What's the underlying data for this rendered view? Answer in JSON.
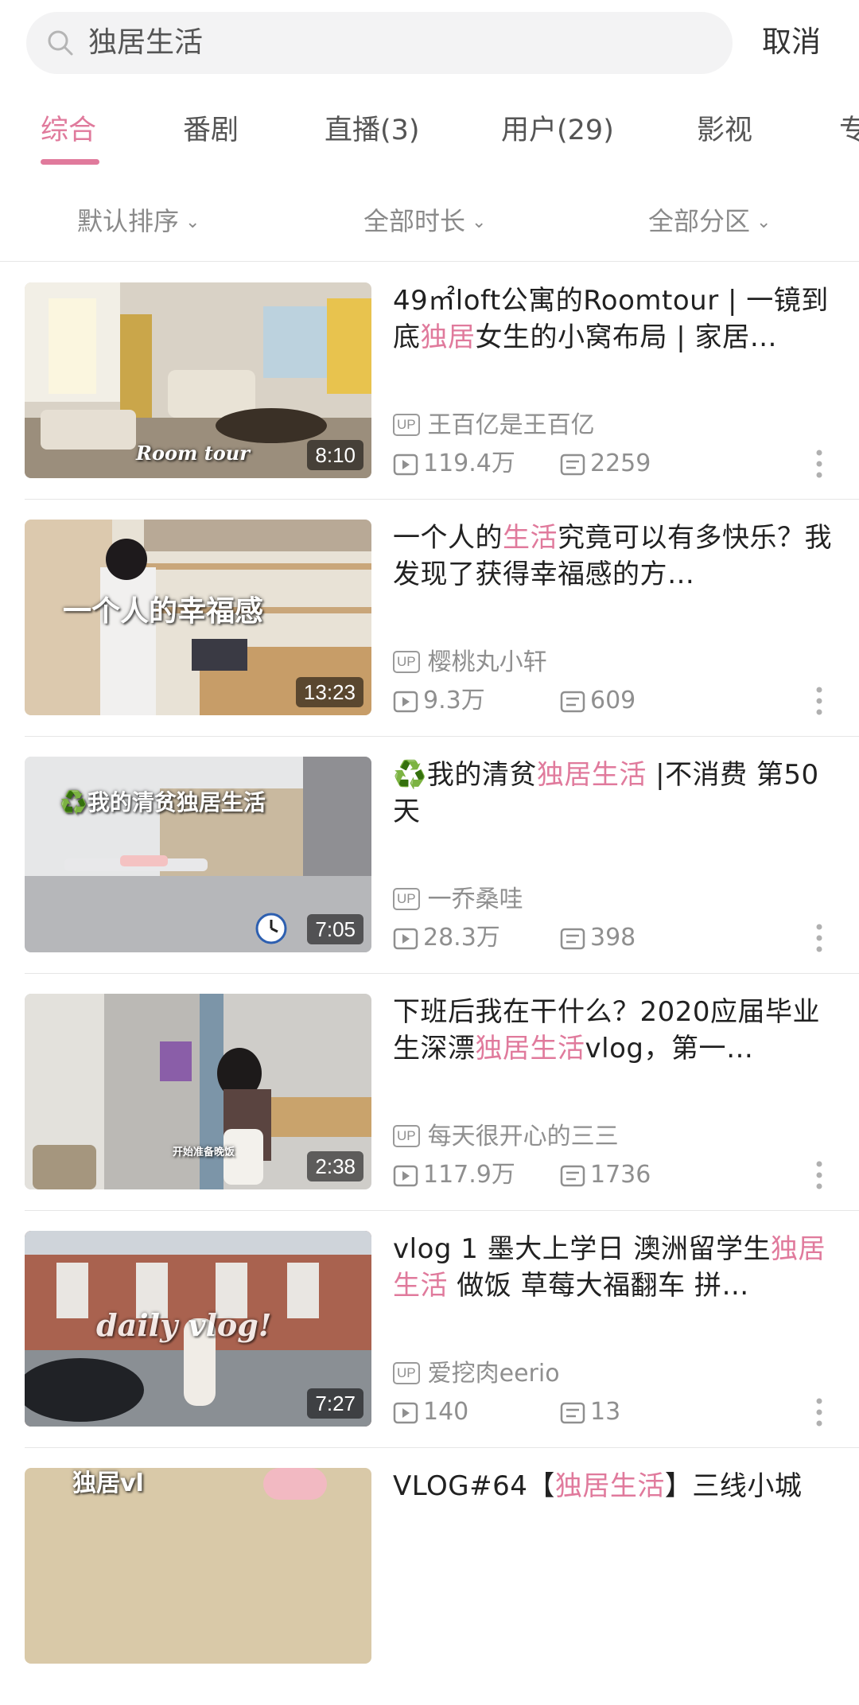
{
  "search": {
    "query": "独居生活",
    "cancel_label": "取消"
  },
  "tabs": [
    {
      "label": "综合",
      "active": true
    },
    {
      "label": "番剧"
    },
    {
      "label": "直播(3)"
    },
    {
      "label": "用户(29)"
    },
    {
      "label": "影视"
    },
    {
      "label": "专"
    }
  ],
  "filters": [
    "默认排序",
    "全部时长",
    "全部分区"
  ],
  "colors": {
    "accent": "#e07a9c",
    "text": "#212121",
    "meta": "#8f8f8f"
  },
  "videos": [
    {
      "title_parts": [
        "49㎡loft公寓的Roomtour | 一镜到底",
        "独居",
        "女生的小窝布局 | 家居…"
      ],
      "author": "王百亿是王百亿",
      "views": "119.4万",
      "comments": "2259",
      "duration": "8:10",
      "overlay": "Room tour"
    },
    {
      "title_parts": [
        "一个人的",
        "生活",
        "究竟可以有多快乐？我发现了获得幸福感的方…"
      ],
      "author": "樱桃丸小轩",
      "views": "9.3万",
      "comments": "609",
      "duration": "13:23",
      "overlay": "一个人的幸福感"
    },
    {
      "title_parts": [
        "♻️我的清贫",
        "独居生活",
        " |不消费 第50天"
      ],
      "author": "一乔桑哇",
      "views": "28.3万",
      "comments": "398",
      "duration": "7:05",
      "overlay": "♻️我的清贫独居生活"
    },
    {
      "title_parts": [
        "下班后我在干什么？2020应届毕业生深漂",
        "独居生活",
        "vlog，第一…"
      ],
      "author": "每天很开心的三三",
      "views": "117.9万",
      "comments": "1736",
      "duration": "2:38",
      "overlay": "开始准备晚饭"
    },
    {
      "title_parts": [
        "vlog 1 墨大上学日 澳洲留学生",
        "独居生活",
        " 做饭 草莓大福翻车 拼…"
      ],
      "author": "爱挖肉eerio",
      "views": "140",
      "comments": "13",
      "duration": "7:27",
      "overlay": "daily vlog!"
    },
    {
      "title_parts": [
        "VLOG#64【",
        "独居生活",
        "】三线小城"
      ],
      "author": "",
      "views": "",
      "comments": "",
      "duration": "",
      "overlay": "独居vl"
    }
  ]
}
